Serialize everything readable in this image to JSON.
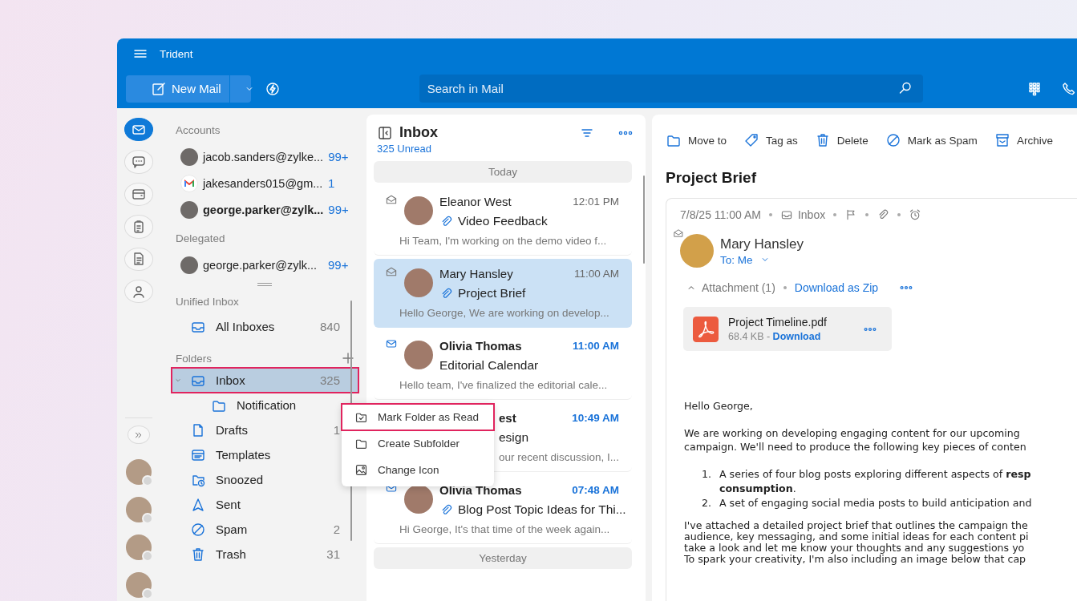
{
  "window": {
    "title": "Trident"
  },
  "toolbar": {
    "new_mail": "New Mail",
    "search": {
      "placeholder": "Search in Mail"
    }
  },
  "rail_apps": [
    {
      "selected": true
    },
    {
      "selected": false
    },
    {
      "selected": false
    },
    {
      "selected": false
    },
    {
      "selected": false
    },
    {
      "selected": false
    }
  ],
  "accounts": {
    "heading": "Accounts",
    "items": [
      {
        "email": "jacob.sanders@zylke...",
        "count": "99+",
        "selected": false,
        "kind": "photo"
      },
      {
        "email": "jakesanders015@gm...",
        "count": "1",
        "selected": false,
        "kind": "gmail"
      },
      {
        "email": "george.parker@zylk...",
        "count": "99+",
        "selected": true,
        "kind": "photo"
      }
    ]
  },
  "delegated": {
    "heading": "Delegated",
    "items": [
      {
        "email": "george.parker@zylk...",
        "count": "99+",
        "selected": false,
        "kind": "photo"
      }
    ]
  },
  "unified": {
    "heading": "Unified Inbox",
    "items": [
      {
        "label": "All Inboxes",
        "count": "840"
      }
    ]
  },
  "folders": {
    "heading": "Folders",
    "items": [
      {
        "kind": "inbox",
        "label": "Inbox",
        "count": "325",
        "selected": true,
        "outlined": true,
        "expanded": true,
        "children": [
          {
            "kind": "folder",
            "label": "Notification",
            "selected": false,
            "outlined": false
          }
        ]
      },
      {
        "kind": "drafts",
        "label": "Drafts",
        "count": "1",
        "selected": false,
        "outlined": false
      },
      {
        "kind": "templates",
        "label": "Templates",
        "selected": false,
        "outlined": false
      },
      {
        "kind": "snoozed",
        "label": "Snoozed",
        "selected": false,
        "outlined": false
      },
      {
        "kind": "sent",
        "label": "Sent",
        "selected": false,
        "outlined": false
      },
      {
        "kind": "spam",
        "label": "Spam",
        "count": "2",
        "selected": false,
        "outlined": false
      },
      {
        "kind": "trash",
        "label": "Trash",
        "count": "31",
        "selected": false,
        "outlined": false
      }
    ]
  },
  "context_menu": {
    "items": [
      {
        "kind": "mark-read",
        "label": "Mark Folder as Read",
        "outlined": true
      },
      {
        "kind": "subfolder",
        "label": "Create Subfolder",
        "outlined": false
      },
      {
        "kind": "icon",
        "label": "Change Icon",
        "outlined": false
      }
    ]
  },
  "message_list": {
    "title": "Inbox",
    "unread": "325 Unread",
    "items": [
      {
        "kind": "divider",
        "label": "Today"
      },
      {
        "kind": "message",
        "sender": "Eleanor West",
        "time": "12:01 PM",
        "subject": "Video Feedback",
        "preview": "Hi Team, I'm working on the demo video f...",
        "unread": false,
        "attachment": true,
        "selected": false,
        "covered": false
      },
      {
        "kind": "message",
        "sender": "Mary Hansley",
        "time": "11:00 AM",
        "subject": "Project Brief",
        "preview": "Hello George, We are working on develop...",
        "unread": false,
        "attachment": true,
        "selected": true,
        "covered": false
      },
      {
        "kind": "message",
        "sender": "Olivia Thomas",
        "time": "11:00 AM",
        "subject": "Editorial Calendar",
        "preview": "Hello team, I've finalized the editorial cale...",
        "unread": true,
        "attachment": false,
        "selected": false,
        "covered": false
      },
      {
        "kind": "message",
        "sender": "est",
        "time": "10:49 AM",
        "subject": "esign",
        "preview": "our recent discussion, I...",
        "unread": true,
        "attachment": false,
        "selected": false,
        "covered": true
      },
      {
        "kind": "message",
        "sender": "Olivia Thomas",
        "time": "07:48 AM",
        "subject": "Blog Post Topic Ideas for Thi...",
        "preview": "Hi George, It's that time of the week again...",
        "unread": true,
        "attachment": true,
        "selected": false,
        "covered": false
      },
      {
        "kind": "divider",
        "label": "Yesterday"
      }
    ]
  },
  "reading_pane": {
    "actions": [
      {
        "kind": "move",
        "label": "Move to"
      },
      {
        "kind": "tag",
        "label": "Tag as"
      },
      {
        "kind": "delete",
        "label": "Delete"
      },
      {
        "kind": "spam",
        "label": "Mark as Spam"
      },
      {
        "kind": "archive",
        "label": "Archive"
      }
    ],
    "subject": "Project Brief",
    "meta": {
      "date": "7/8/25 11:00 AM",
      "folder": "Inbox"
    },
    "sender": {
      "name": "Mary Hansley",
      "to": "To: Me"
    },
    "attachments": {
      "label": "Attachment (1)",
      "download_all": "Download as Zip",
      "files": [
        {
          "name": "Project Timeline.pdf",
          "size": "68.4 KB -",
          "download": "Download"
        }
      ]
    },
    "body": {
      "greeting": "Hello George,",
      "intro": [
        "We are working on developing engaging content for our upcoming",
        "campaign. We'll need to produce the following key pieces of conten"
      ],
      "list": [
        {
          "marker": "1.",
          "lines": [
            "A series of four blog posts exploring different aspects of **resp**",
            "**consumption**."
          ]
        },
        {
          "marker": "2.",
          "lines": [
            "A set of engaging social media posts to build anticipation and"
          ]
        }
      ],
      "closing": [
        "I've attached a detailed project brief that outlines the campaign the",
        "audience, key messaging, and some initial ideas for each content pi",
        "take a look and let me know your thoughts and any suggestions yo",
        "To spark your creativity, I'm also including an image below that cap"
      ]
    }
  }
}
